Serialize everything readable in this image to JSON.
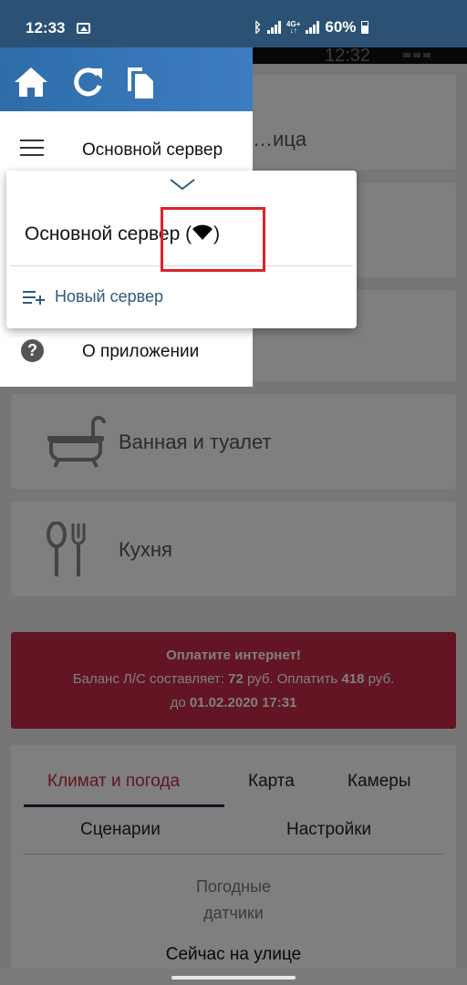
{
  "status_bar": {
    "time": "12:33",
    "network_type": "4G+",
    "battery": "60%"
  },
  "background": {
    "inner_time": "12:32",
    "rooms": [
      {
        "label": "…ица"
      },
      {
        "label": "Ванная и туалет"
      },
      {
        "label": "Кухня"
      }
    ],
    "alert": {
      "title": "Оплатите интернет!",
      "line2_a": "Баланс Л/С составляет: ",
      "line2_b": "72",
      "line2_c": " руб. Оплатить ",
      "line2_d": "418",
      "line2_e": " руб.",
      "line3_a": "до ",
      "line3_b": "01.02.2020 17:31",
      "color": "#c62a47"
    },
    "tabs": {
      "climate": "Климат и погода",
      "map": "Карта",
      "cameras": "Камеры",
      "scenarios": "Сценарии",
      "settings": "Настройки"
    },
    "weather_title_1": "Погодные",
    "weather_title_2": "датчики",
    "outside": "Сейчас на улице"
  },
  "drawer": {
    "header_color": "#2e6da9",
    "server_item": "Основной сервер",
    "about_item": "О приложении"
  },
  "popup": {
    "server_name": "Основной сервер (",
    "server_suffix": ")",
    "new_server": "Новый сервер",
    "accent": "#2e5a7a"
  }
}
